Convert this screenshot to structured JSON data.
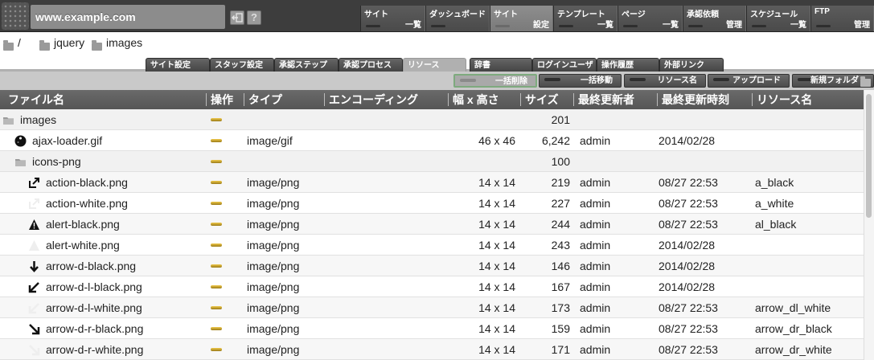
{
  "header": {
    "site_host": "www.example.com",
    "logout_icon": "logout-icon",
    "help_label": "?",
    "nav": [
      {
        "top": "サイト",
        "bottom": "一覧"
      },
      {
        "top": "ダッシュボード",
        "bottom": ""
      },
      {
        "top": "サイト",
        "bottom": "設定"
      },
      {
        "top": "テンプレート",
        "bottom": "一覧"
      },
      {
        "top": "ページ",
        "bottom": "一覧"
      },
      {
        "top": "承認依頼",
        "bottom": "管理"
      },
      {
        "top": "スケジュール",
        "bottom": "一覧"
      },
      {
        "top": "FTP",
        "bottom": "管理"
      }
    ]
  },
  "breadcrumb": {
    "root": "/",
    "items": [
      "jquery",
      "images"
    ]
  },
  "tabs": [
    "サイト設定",
    "スタッフ設定",
    "承認ステップ",
    "承認プロセス",
    "リソース",
    "辞書",
    "ログインユーザ",
    "操作履歴",
    "外部リンク"
  ],
  "active_tab": "リソース",
  "actions": [
    "一括削除",
    "一括移動",
    "リソース名",
    "アップロード",
    "新規フォルダ"
  ],
  "table": {
    "columns": [
      "ファイル名",
      "操作",
      "タイプ",
      "エンコーディング",
      "幅 x 高さ",
      "サイズ",
      "最終更新者",
      "最終更新時刻",
      "リソース名"
    ],
    "rows": [
      {
        "name": "images",
        "icon": "folder-icon",
        "type": "",
        "dim": "",
        "size": "201",
        "user": "",
        "time": "",
        "res": "",
        "kind": "folder"
      },
      {
        "name": "ajax-loader.gif",
        "icon": "loader-icon",
        "type": "image/gif",
        "dim": "46 x 46",
        "size": "6,242",
        "user": "admin",
        "time": "2014/02/28",
        "res": "",
        "kind": "file"
      },
      {
        "name": "icons-png",
        "icon": "folder-icon",
        "type": "",
        "dim": "",
        "size": "100",
        "user": "",
        "time": "",
        "res": "",
        "kind": "folder"
      },
      {
        "name": "action-black.png",
        "icon": "action-icon",
        "type": "image/png",
        "dim": "14 x 14",
        "size": "219",
        "user": "admin",
        "time": "08/27 22:53",
        "res": "a_black",
        "kind": "file"
      },
      {
        "name": "action-white.png",
        "icon": "action-white-icon",
        "type": "image/png",
        "dim": "14 x 14",
        "size": "227",
        "user": "admin",
        "time": "08/27 22:53",
        "res": "a_white",
        "kind": "file"
      },
      {
        "name": "alert-black.png",
        "icon": "alert-icon",
        "type": "image/png",
        "dim": "14 x 14",
        "size": "244",
        "user": "admin",
        "time": "08/27 22:53",
        "res": "al_black",
        "kind": "file"
      },
      {
        "name": "alert-white.png",
        "icon": "alert-white-icon",
        "type": "image/png",
        "dim": "14 x 14",
        "size": "243",
        "user": "admin",
        "time": "2014/02/28",
        "res": "",
        "kind": "file"
      },
      {
        "name": "arrow-d-black.png",
        "icon": "arrow-down-icon",
        "type": "image/png",
        "dim": "14 x 14",
        "size": "146",
        "user": "admin",
        "time": "2014/02/28",
        "res": "",
        "kind": "file"
      },
      {
        "name": "arrow-d-l-black.png",
        "icon": "arrow-down-left-icon",
        "type": "image/png",
        "dim": "14 x 14",
        "size": "167",
        "user": "admin",
        "time": "2014/02/28",
        "res": "",
        "kind": "file"
      },
      {
        "name": "arrow-d-l-white.png",
        "icon": "arrow-down-left-white-icon",
        "type": "image/png",
        "dim": "14 x 14",
        "size": "173",
        "user": "admin",
        "time": "08/27 22:53",
        "res": "arrow_dl_white",
        "kind": "file"
      },
      {
        "name": "arrow-d-r-black.png",
        "icon": "arrow-down-right-icon",
        "type": "image/png",
        "dim": "14 x 14",
        "size": "159",
        "user": "admin",
        "time": "08/27 22:53",
        "res": "arrow_dr_black",
        "kind": "file"
      },
      {
        "name": "arrow-d-r-white.png",
        "icon": "arrow-down-right-white-icon",
        "type": "image/png",
        "dim": "14 x 14",
        "size": "171",
        "user": "admin",
        "time": "08/27 22:53",
        "res": "arrow_dr_white",
        "kind": "file"
      }
    ]
  },
  "colors": {
    "header_bg": "#3d3d3d",
    "active_nav": "#8e8e8e",
    "accent_gold": "#d4a82a"
  }
}
